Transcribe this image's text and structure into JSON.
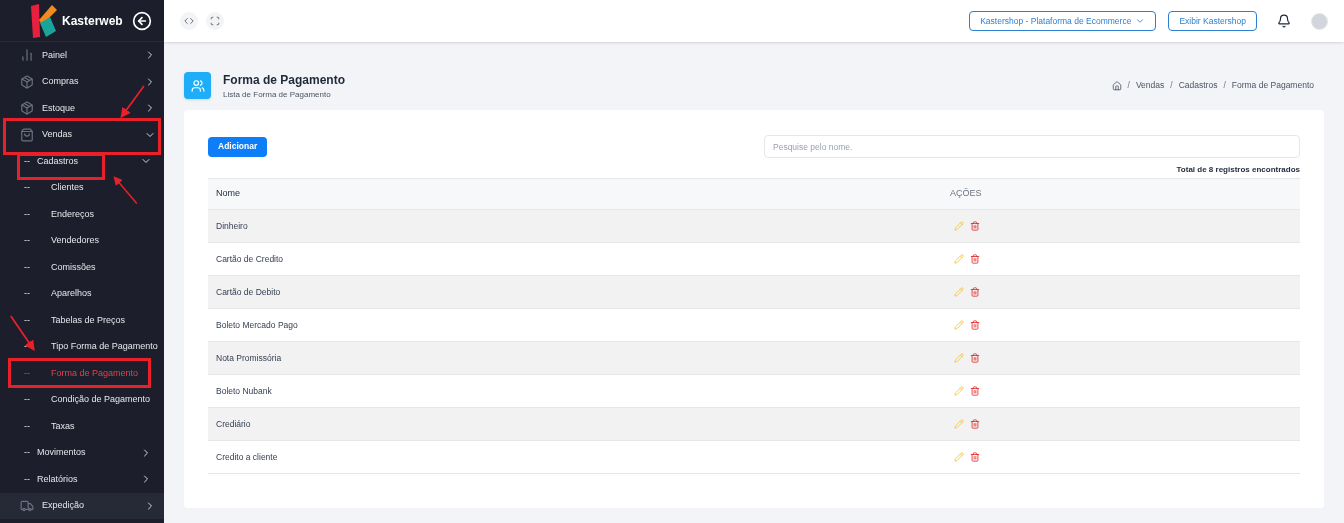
{
  "brand": {
    "name": "Kasterweb"
  },
  "sidebar": {
    "items": [
      {
        "label": "Painel",
        "expanded": false,
        "selected": false
      },
      {
        "label": "Compras",
        "expanded": false,
        "selected": false
      },
      {
        "label": "Estoque",
        "expanded": false,
        "selected": false
      },
      {
        "label": "Vendas",
        "expanded": true,
        "selected": false,
        "children": [
          {
            "prefix": "--",
            "label": "Cadastros",
            "expanded": true,
            "selected": false,
            "children": [
              {
                "prefix": "--",
                "label": "Clientes",
                "selected": false
              },
              {
                "prefix": "--",
                "label": "Endereços",
                "selected": false
              },
              {
                "prefix": "--",
                "label": "Vendedores",
                "selected": false
              },
              {
                "prefix": "--",
                "label": "Comissões",
                "selected": false
              },
              {
                "prefix": "--",
                "label": "Aparelhos",
                "selected": false
              },
              {
                "prefix": "--",
                "label": "Tabelas de Preços",
                "selected": false
              },
              {
                "prefix": "--",
                "label": "Tipo Forma de Pagamento",
                "selected": false
              },
              {
                "prefix": "--",
                "label": "Forma de Pagamento",
                "selected": true
              },
              {
                "prefix": "--",
                "label": "Condição de Pagamento",
                "selected": false
              },
              {
                "prefix": "--",
                "label": "Taxas",
                "selected": false
              }
            ]
          },
          {
            "prefix": "--",
            "label": "Movimentos",
            "expanded": false,
            "selected": false
          },
          {
            "prefix": "--",
            "label": "Relatórios",
            "expanded": false,
            "selected": false
          }
        ]
      },
      {
        "label": "Expedição",
        "expanded": false,
        "selected": false
      }
    ]
  },
  "topbar": {
    "store_select": "Kastershop - Plataforma de Ecommerce",
    "view_button": "Exibir Kastershop"
  },
  "page": {
    "title": "Forma de Pagamento",
    "subtitle": "Lista de Forma de Pagamento",
    "breadcrumb_separator": "/",
    "breadcrumb": [
      "Vendas",
      "Cadastros",
      "Forma de Pagamento"
    ]
  },
  "toolbar": {
    "add_button": "Adicionar",
    "search": {
      "placeholder": "Pesquise pelo nome."
    },
    "total": "Total de 8 registros encontrados"
  },
  "table": {
    "columns": [
      "Nome",
      "AÇÕES"
    ],
    "rows": [
      {
        "name": "Dinheiro"
      },
      {
        "name": "Cartão de Credito"
      },
      {
        "name": "Cartão de Debito"
      },
      {
        "name": "Boleto Mercado Pago"
      },
      {
        "name": "Nota Promissória"
      },
      {
        "name": "Boleto Nubank"
      },
      {
        "name": "Crediário"
      },
      {
        "name": "Credito a cliente"
      }
    ]
  }
}
